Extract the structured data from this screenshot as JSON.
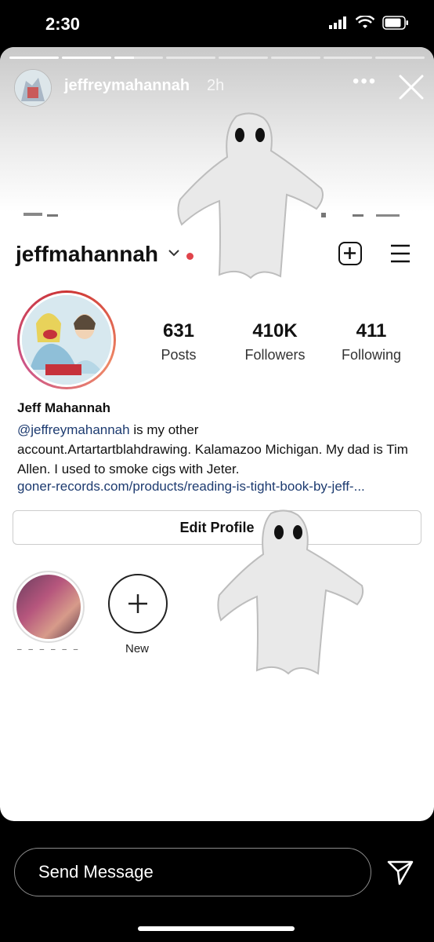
{
  "status_bar": {
    "time": "2:30"
  },
  "story": {
    "username": "jeffreymahannah",
    "age": "2h",
    "more": "•••"
  },
  "profile": {
    "handle": "jeffmahannah",
    "stats": [
      {
        "value": "631",
        "label": "Posts"
      },
      {
        "value": "410K",
        "label": "Followers"
      },
      {
        "value": "411",
        "label": "Following"
      }
    ],
    "name": "Jeff Mahannah",
    "bio_mention": "@jeffreymahannah",
    "bio_line1_rest": " is my other",
    "bio_rest": "account.Artartartblahdrawing. Kalamazoo Michigan. My dad is Tim Allen. I used to smoke cigs with Jeter.",
    "link": "goner-records.com/products/reading-is-tight-book-by-jeff-...",
    "edit_profile_label": "Edit Profile",
    "highlight_new_label": "New"
  },
  "footer": {
    "message_placeholder": "Send Message"
  },
  "colors": {
    "notification_dot": "#e0434b",
    "link": "#1d3b70"
  }
}
